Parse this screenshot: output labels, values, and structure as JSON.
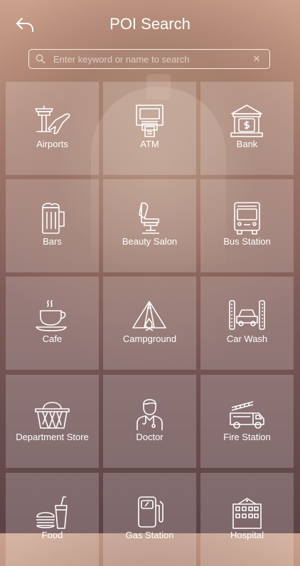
{
  "header": {
    "title": "POI Search",
    "back_icon": "back-arrow-icon"
  },
  "search": {
    "placeholder": "Enter keyword or name to search",
    "value": "",
    "icon": "search-icon",
    "clear_icon": "clear-icon"
  },
  "categories": [
    {
      "label": "Airports",
      "icon": "airport-icon"
    },
    {
      "label": "ATM",
      "icon": "atm-icon"
    },
    {
      "label": "Bank",
      "icon": "bank-icon"
    },
    {
      "label": "Bars",
      "icon": "beer-mug-icon"
    },
    {
      "label": "Beauty Salon",
      "icon": "salon-chair-icon"
    },
    {
      "label": "Bus Station",
      "icon": "bus-icon"
    },
    {
      "label": "Cafe",
      "icon": "coffee-cup-icon"
    },
    {
      "label": "Campground",
      "icon": "tent-icon"
    },
    {
      "label": "Car Wash",
      "icon": "car-wash-icon"
    },
    {
      "label": "Department Store",
      "icon": "basket-icon"
    },
    {
      "label": "Doctor",
      "icon": "doctor-icon"
    },
    {
      "label": "Fire Station",
      "icon": "fire-truck-icon"
    },
    {
      "label": "Food",
      "icon": "fast-food-icon"
    },
    {
      "label": "Gas Station",
      "icon": "gas-pump-icon"
    },
    {
      "label": "Hospital",
      "icon": "hospital-icon"
    }
  ]
}
